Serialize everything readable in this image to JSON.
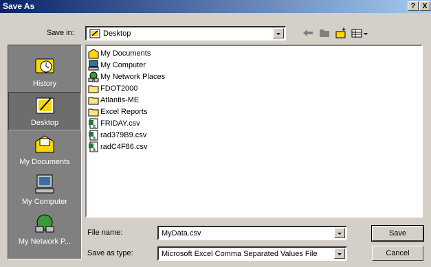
{
  "title": "Save As",
  "title_buttons": {
    "help": "?",
    "close": "X"
  },
  "save_in": {
    "label": "Save in:",
    "value": "Desktop"
  },
  "places": [
    {
      "label": "History",
      "icon": "history-icon"
    },
    {
      "label": "Desktop",
      "icon": "desktop-icon",
      "selected": true
    },
    {
      "label": "My Documents",
      "icon": "my-documents-icon"
    },
    {
      "label": "My Computer",
      "icon": "my-computer-icon"
    },
    {
      "label": "My Network P...",
      "icon": "network-places-icon"
    }
  ],
  "files": [
    {
      "name": "My Documents",
      "icon": "my-documents-icon"
    },
    {
      "name": "My Computer",
      "icon": "my-computer-icon"
    },
    {
      "name": "My Network Places",
      "icon": "network-places-icon"
    },
    {
      "name": "FDOT2000",
      "icon": "folder-icon"
    },
    {
      "name": "Atlantis-ME",
      "icon": "folder-icon"
    },
    {
      "name": "Excel Reports",
      "icon": "folder-icon"
    },
    {
      "name": "FRIDAY.csv",
      "icon": "csv-file-icon"
    },
    {
      "name": "rad379B9.csv",
      "icon": "csv-file-icon"
    },
    {
      "name": "radC4F86.csv",
      "icon": "csv-file-icon"
    }
  ],
  "file_name": {
    "label": "File name:",
    "value": "MyData.csv"
  },
  "save_as_type": {
    "label": "Save as type:",
    "value": "Microsoft Excel Comma Separated Values File"
  },
  "buttons": {
    "save": "Save",
    "cancel": "Cancel"
  },
  "colors": {
    "title_start": "#0a246a",
    "title_end": "#a6caf0",
    "dialog": "#d4d0c8",
    "places_bar": "#808080"
  }
}
